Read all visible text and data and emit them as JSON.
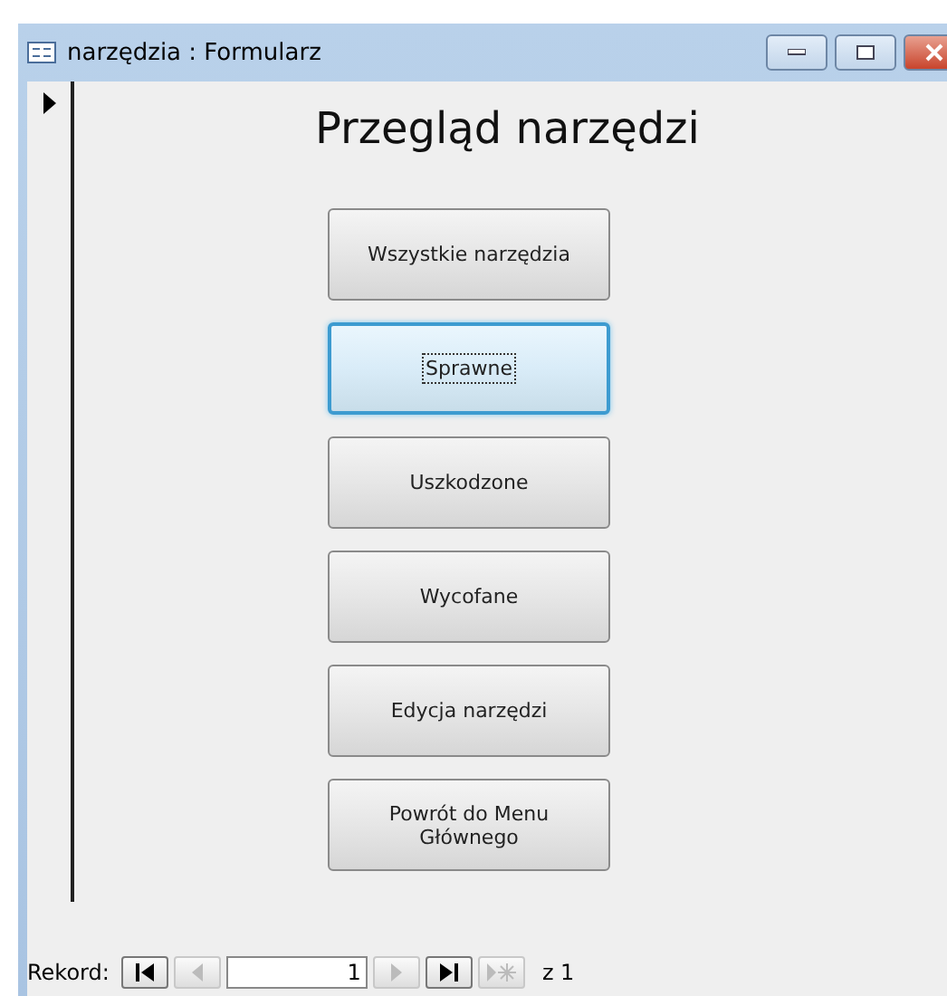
{
  "window": {
    "title": "narzędzia : Formularz"
  },
  "heading": "Przegląd narzędzi",
  "buttons": [
    {
      "label": "Wszystkie narzędzia",
      "focused": false
    },
    {
      "label": "Sprawne",
      "focused": true
    },
    {
      "label": "Uszkodzone",
      "focused": false
    },
    {
      "label": "Wycofane",
      "focused": false
    },
    {
      "label": "Edycja narzędzi",
      "focused": false
    },
    {
      "label": "Powrót do Menu Głównego",
      "focused": false
    }
  ],
  "navigator": {
    "label": "Rekord:",
    "record": "1",
    "total": "z 1",
    "controls": [
      {
        "kind": "first",
        "disabled": false
      },
      {
        "kind": "prev",
        "disabled": true
      },
      {
        "kind": "field"
      },
      {
        "kind": "next",
        "disabled": true
      },
      {
        "kind": "last",
        "disabled": false
      },
      {
        "kind": "new",
        "disabled": true
      }
    ]
  }
}
